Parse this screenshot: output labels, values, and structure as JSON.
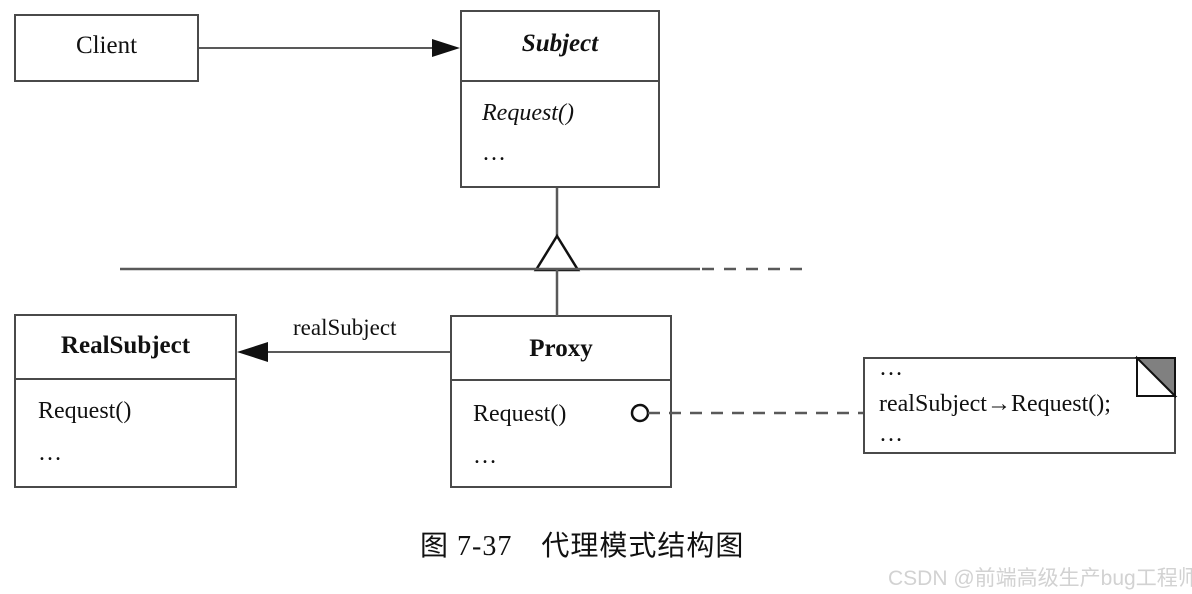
{
  "diagram": {
    "title_caption": "图 7-37　代理模式结构图",
    "watermark": "CSDN @前端高级生产bug工程师",
    "colors": {
      "stroke": "#4a4a4a",
      "line": "#595959",
      "text": "#111111",
      "note_fold_fill": "#808080",
      "background": "#ffffff",
      "watermark": "#d2d2d2"
    },
    "classes": [
      {
        "id": "client",
        "name": "Client",
        "style": "plain",
        "has_members": false,
        "members": []
      },
      {
        "id": "subject",
        "name": "Subject",
        "style": "bold-italic",
        "has_members": true,
        "members": [
          "Request()",
          "…"
        ]
      },
      {
        "id": "realsubject",
        "name": "RealSubject",
        "style": "bold",
        "has_members": true,
        "members": [
          "Request()",
          "…"
        ]
      },
      {
        "id": "proxy",
        "name": "Proxy",
        "style": "bold",
        "has_members": true,
        "members": [
          "Request()",
          "…"
        ]
      }
    ],
    "note": {
      "lines": [
        "…",
        "realSubject→Request();",
        "…"
      ]
    },
    "edges": [
      {
        "id": "client-to-subject",
        "kind": "association-arrow",
        "from": "client",
        "to": "subject",
        "label": ""
      },
      {
        "id": "proxy-to-subject",
        "kind": "generalization",
        "from": "proxy",
        "to": "subject",
        "label": ""
      },
      {
        "id": "realsubject-to-subject",
        "kind": "generalization",
        "from": "realsubject",
        "to": "subject",
        "label": ""
      },
      {
        "id": "proxy-to-realsubject",
        "kind": "association-arrow",
        "from": "proxy",
        "to": "realsubject",
        "label": "realSubject"
      },
      {
        "id": "proxy-to-note",
        "kind": "note-anchor-dashed",
        "from": "proxy",
        "to": "note",
        "label": ""
      }
    ]
  }
}
